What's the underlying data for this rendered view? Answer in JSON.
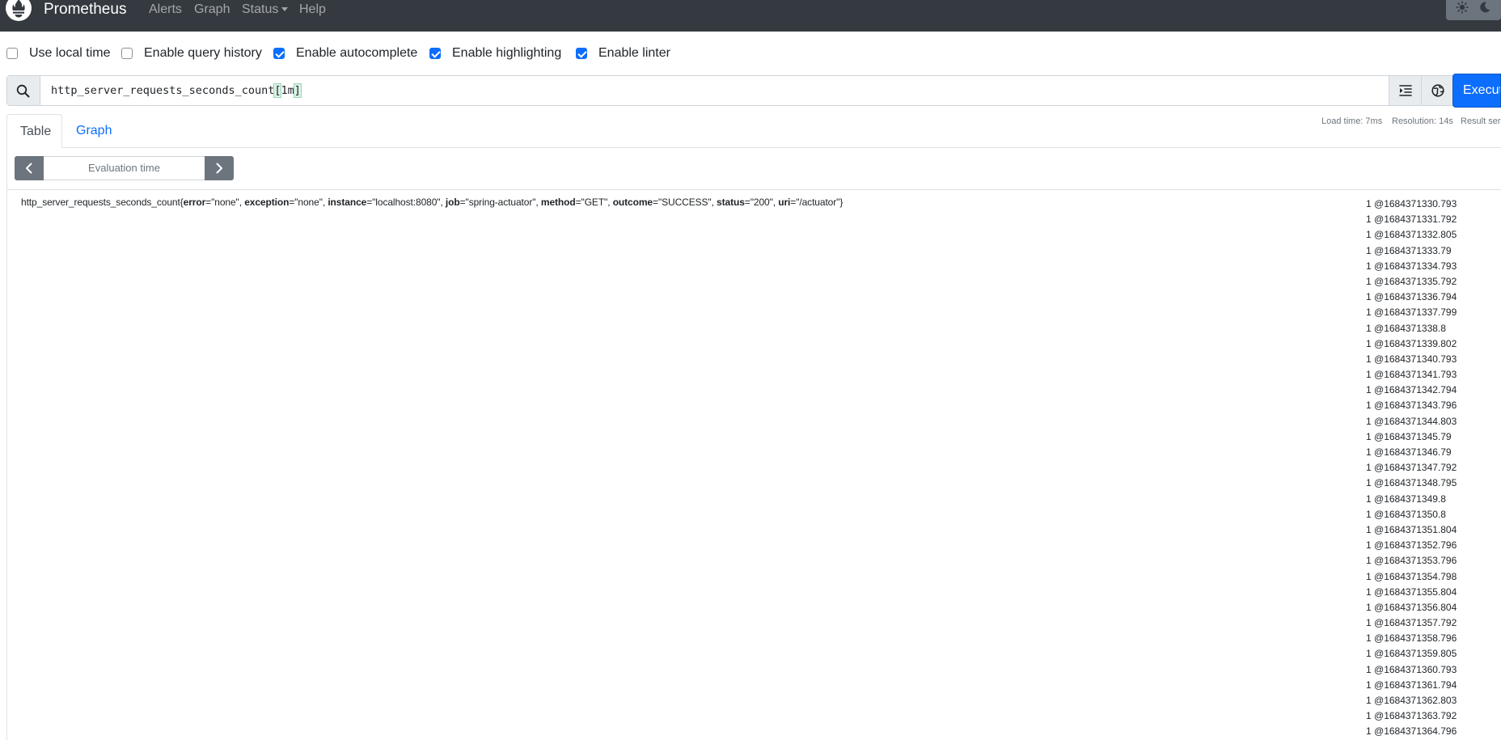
{
  "navbar": {
    "brand": "Prometheus",
    "links": {
      "alerts": "Alerts",
      "graph": "Graph",
      "status": "Status",
      "help": "Help"
    }
  },
  "options": {
    "local_time": {
      "label": "Use local time",
      "checked": false
    },
    "query_history": {
      "label": "Enable query history",
      "checked": false
    },
    "autocomplete": {
      "label": "Enable autocomplete",
      "checked": true
    },
    "highlighting": {
      "label": "Enable highlighting",
      "checked": true
    },
    "linter": {
      "label": "Enable linter",
      "checked": true
    }
  },
  "query": {
    "metric": "http_server_requests_seconds_count",
    "open_bracket": "[",
    "range": "1m",
    "close_bracket": "]"
  },
  "execute_label": "Execut",
  "tabs": {
    "table": "Table",
    "graph": "Graph"
  },
  "stats": {
    "load_time": "Load time: 7ms",
    "resolution": "Resolution: 14s",
    "result_series": "Result ser"
  },
  "eval_time_placeholder": "Evaluation time",
  "result": {
    "metric_name": "http_server_requests_seconds_count",
    "labels": [
      {
        "key": "error",
        "value": "\"none\""
      },
      {
        "key": "exception",
        "value": "\"none\""
      },
      {
        "key": "instance",
        "value": "\"localhost:8080\""
      },
      {
        "key": "job",
        "value": "\"spring-actuator\""
      },
      {
        "key": "method",
        "value": "\"GET\""
      },
      {
        "key": "outcome",
        "value": "\"SUCCESS\""
      },
      {
        "key": "status",
        "value": "\"200\""
      },
      {
        "key": "uri",
        "value": "\"/actuator\""
      }
    ],
    "samples": [
      "1 @1684371330.793",
      "1 @1684371331.792",
      "1 @1684371332.805",
      "1 @1684371333.79",
      "1 @1684371334.793",
      "1 @1684371335.792",
      "1 @1684371336.794",
      "1 @1684371337.799",
      "1 @1684371338.8",
      "1 @1684371339.802",
      "1 @1684371340.793",
      "1 @1684371341.793",
      "1 @1684371342.794",
      "1 @1684371343.796",
      "1 @1684371344.803",
      "1 @1684371345.79",
      "1 @1684371346.79",
      "1 @1684371347.792",
      "1 @1684371348.795",
      "1 @1684371349.8",
      "1 @1684371350.8",
      "1 @1684371351.804",
      "1 @1684371352.796",
      "1 @1684371353.796",
      "1 @1684371354.798",
      "1 @1684371355.804",
      "1 @1684371356.804",
      "1 @1684371357.792",
      "1 @1684371358.796",
      "1 @1684371359.805",
      "1 @1684371360.793",
      "1 @1684371361.794",
      "1 @1684371362.803",
      "1 @1684371363.792",
      "1 @1684371364.796"
    ]
  }
}
